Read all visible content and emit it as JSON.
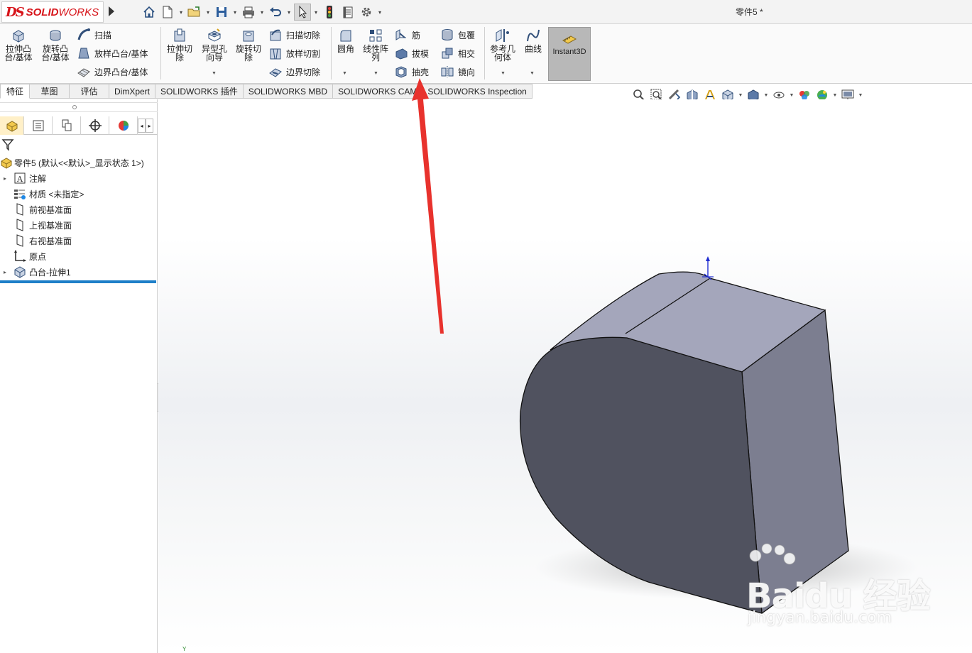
{
  "app": {
    "logo_ds": "DS",
    "logo_word_a": "SOLID",
    "logo_word_b": "WORKS",
    "document_title": "零件5 *"
  },
  "ribbon": {
    "extrude_boss": "拉伸凸台/基体",
    "revolve_boss": "旋转凸台/基体",
    "sweep": "扫描",
    "loft_boss": "放样凸台/基体",
    "boundary_boss": "边界凸台/基体",
    "extrude_cut": "拉伸切除",
    "hole_wizard": "异型孔向导",
    "revolve_cut": "旋转切除",
    "swept_cut": "扫描切除",
    "lofted_cut": "放样切割",
    "boundary_cut": "边界切除",
    "fillet": "圆角",
    "linear_pattern": "线性阵列",
    "rib": "筋",
    "draft": "拔模",
    "shell": "抽壳",
    "wrap": "包覆",
    "intersect": "相交",
    "mirror": "镜向",
    "ref_geometry": "参考几何体",
    "curves": "曲线",
    "instant3d": "Instant3D"
  },
  "tabs": [
    "特征",
    "草图",
    "评估",
    "DimXpert",
    "SOLIDWORKS 插件",
    "SOLIDWORKS MBD",
    "SOLIDWORKS CAM",
    "SOLIDWORKS Inspection"
  ],
  "tree": {
    "root": "零件5  (默认<<默认>_显示状态 1>)",
    "annotations": "注解",
    "material": "材质 <未指定>",
    "front_plane": "前视基准面",
    "top_plane": "上视基准面",
    "right_plane": "右视基准面",
    "origin": "原点",
    "boss_extrude": "凸台-拉伸1"
  },
  "watermark": {
    "brand": "Baidu 经验",
    "url": "jingyan.baidu.com"
  },
  "triad": {
    "y_label": "Y"
  },
  "colors": {
    "accent_red": "#d7141a",
    "annotation_arrow": "#e8322d",
    "model_front": "#50525f",
    "model_side": "#7c7e90",
    "model_top": "#a4a6bb",
    "tree_selection_bar": "#1e7fc8"
  }
}
